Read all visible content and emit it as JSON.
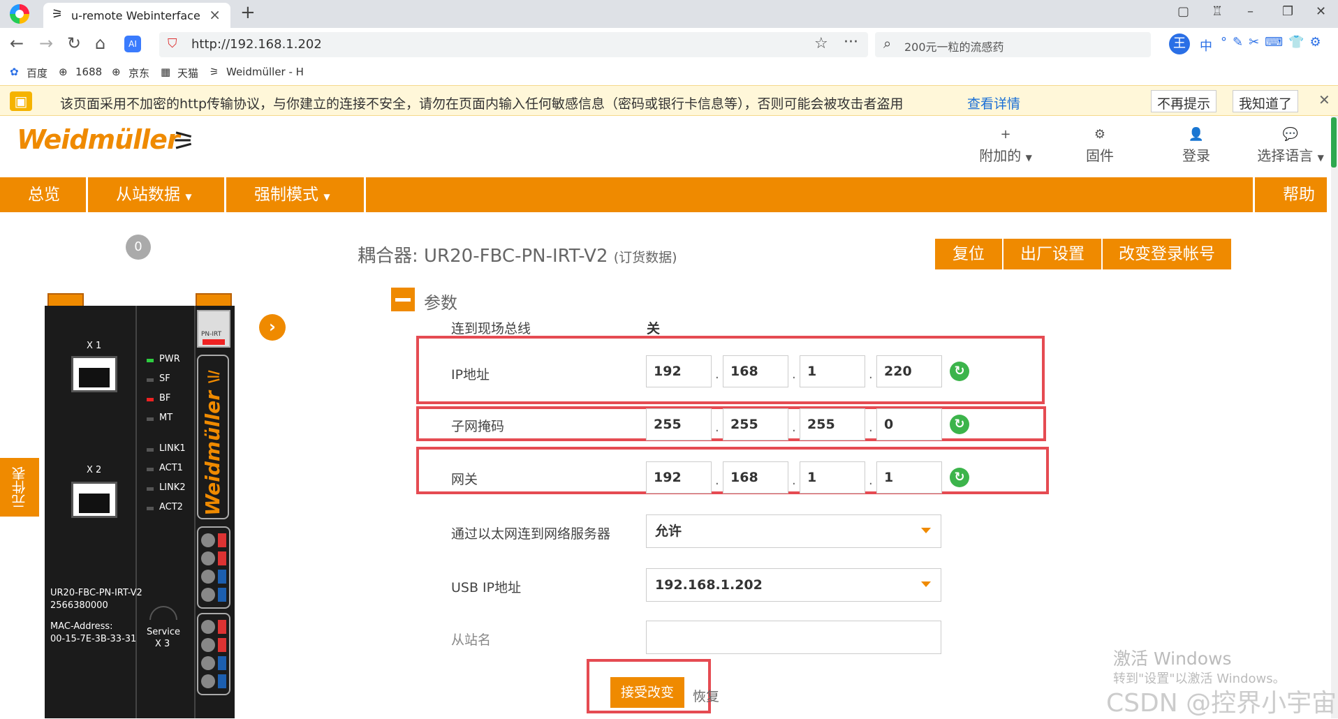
{
  "browser": {
    "tab_title": "u-remote Webinterface",
    "url": "http://192.168.1.202",
    "search_placeholder": "200元一粒的流感药",
    "bookmarks": [
      "百度",
      "1688",
      "京东",
      "天猫",
      "Weidmüller - H"
    ],
    "ime_label": "中"
  },
  "warning": {
    "text": "该页面采用不加密的http传输协议，与你建立的连接不安全，请勿在页面内输入任何敏感信息（密码或银行卡信息等），否则可能会被攻击者盗用",
    "link": "查看详情",
    "dont_show": "不再提示",
    "got_it": "我知道了"
  },
  "header": {
    "brand": "Weidmüller",
    "items": [
      {
        "icon": "plus-icon",
        "label": "附加的"
      },
      {
        "icon": "gear-icon",
        "label": "固件"
      },
      {
        "icon": "user-icon",
        "label": "登录"
      },
      {
        "icon": "chat-icon",
        "label": "选择语言"
      }
    ]
  },
  "nav": {
    "overview": "总览",
    "slave_data": "从站数据",
    "force_mode": "强制模式",
    "help": "帮助"
  },
  "device": {
    "counter": "0",
    "side_tab": "元件表",
    "x1": "X 1",
    "x2": "X 2",
    "x3": "X 3",
    "service": "Service",
    "model": "UR20-FBC-PN-IRT-V2",
    "order_no": "2566380000",
    "mac_label": "MAC-Address:",
    "mac": "00-15-7E-3B-33-31",
    "pn_irt": "PN-IRT",
    "leds": [
      "PWR",
      "SF",
      "BF",
      "MT",
      "LINK1",
      "ACT1",
      "LINK2",
      "ACT2"
    ],
    "brand_vertical": "Weidmüller"
  },
  "main": {
    "coupler_prefix": "耦合器: UR20-FBC-PN-IRT-V2",
    "coupler_sub": "(订货数据)",
    "buttons": {
      "reset": "复位",
      "factory": "出厂设置",
      "change_login": "改变登录帐号"
    },
    "section": "参数",
    "fieldbus_label": "连到现场总线",
    "fieldbus_value": "关",
    "ip_label": "IP地址",
    "ip": [
      "192",
      "168",
      "1",
      "220"
    ],
    "mask_label": "子网掩码",
    "mask": [
      "255",
      "255",
      "255",
      "0"
    ],
    "gateway_label": "网关",
    "gateway": [
      "192",
      "168",
      "1",
      "1"
    ],
    "server_label": "通过以太网连到网络服务器",
    "server_value": "允许",
    "usb_label": "USB IP地址",
    "usb_value": "192.168.1.202",
    "station_label": "从站名",
    "station_value": "",
    "accept": "接受改变",
    "restore": "恢复"
  },
  "watermark": {
    "line1": "激活 Windows",
    "line2": "转到\"设置\"以激活 Windows。",
    "csdn": "CSDN @控界小宇宙"
  },
  "colors": {
    "accent": "#ef8a00",
    "highlight_border": "#e54b52",
    "refresh": "#3cb44b",
    "link": "#1a6fd6"
  }
}
